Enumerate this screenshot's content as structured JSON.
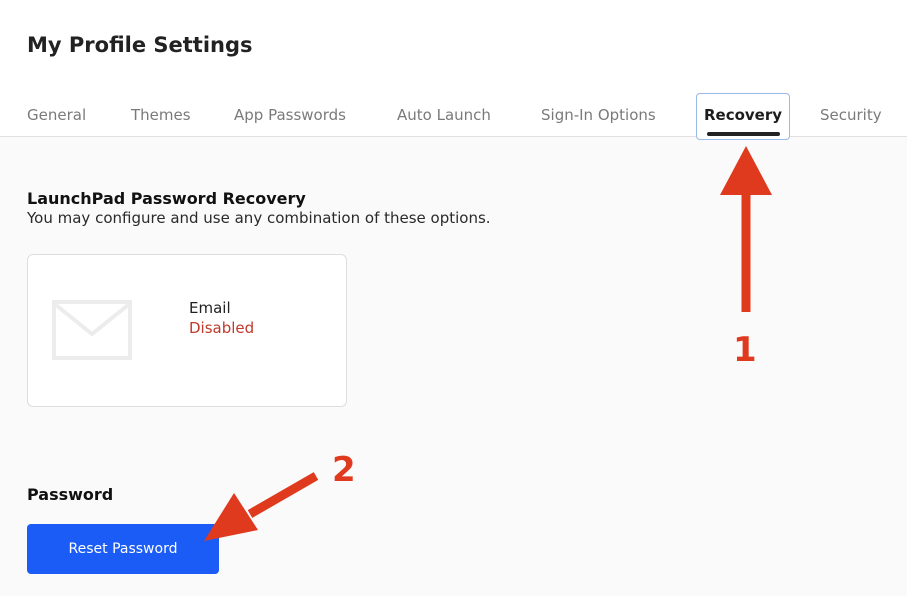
{
  "page": {
    "title": "My Profile Settings"
  },
  "tabs": [
    {
      "label": "General"
    },
    {
      "label": "Themes"
    },
    {
      "label": "App Passwords"
    },
    {
      "label": "Auto Launch"
    },
    {
      "label": "Sign-In Options"
    },
    {
      "label": "Recovery",
      "active": true
    },
    {
      "label": "Security"
    }
  ],
  "recovery": {
    "heading": "LaunchPad Password Recovery",
    "description": "You may configure and use any combination of these options.",
    "options": [
      {
        "name": "Email",
        "status": "Disabled",
        "icon": "envelope-icon",
        "status_color": "#c0392b"
      }
    ]
  },
  "password": {
    "label": "Password",
    "reset_button": "Reset Password"
  },
  "annotations": {
    "step1": "1",
    "step2": "2",
    "color": "#e03a1e"
  },
  "colors": {
    "primary_button": "#1a5cf5",
    "active_tab_border": "#9bb8ea"
  }
}
